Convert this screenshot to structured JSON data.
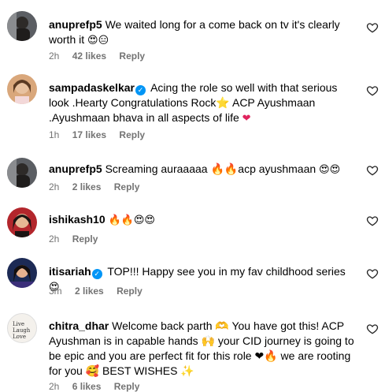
{
  "comments": [
    {
      "username": "anuprefp5",
      "verified": false,
      "text": "We waited long for a come back on tv it's clearly worth it",
      "emoji": "😍😑",
      "time": "2h",
      "likes": "42 likes",
      "reply": "Reply"
    },
    {
      "username": "sampadaskelkar",
      "verified": true,
      "text": "Acing the role so well with that serious look .Hearty Congratulations Rock⭐ ACP Ayushmaan .Ayushmaan bhava in all aspects of life",
      "emoji": "❤",
      "time": "1h",
      "likes": "17 likes",
      "reply": "Reply"
    },
    {
      "username": "anuprefp5",
      "verified": false,
      "text": "Screaming auraaaaa 🔥🔥acp ayushmaan",
      "emoji": "😍😍",
      "time": "2h",
      "likes": "2 likes",
      "reply": "Reply"
    },
    {
      "username": "ishikash10",
      "verified": false,
      "text": "",
      "emoji": "🔥🔥😍😍",
      "time": "2h",
      "likes": "",
      "reply": "Reply"
    },
    {
      "username": "itisariah",
      "verified": true,
      "text": "TOP!!! Happy see you in my fav childhood series",
      "emoji": "😍",
      "time": "3m",
      "likes": "2 likes",
      "reply": "Reply"
    },
    {
      "username": "chitra_dhar",
      "verified": false,
      "text": "Welcome back parth 🫶 You have got this! ACP Ayushman is in capable hands 🙌 your CID journey is going to be epic and you are perfect fit for this role ❤🔥 we are rooting for you 🥰 BEST WISHES ✨",
      "emoji": "",
      "time": "2h",
      "likes": "6 likes",
      "reply": "Reply"
    }
  ],
  "avatar_text": "Live Laugh Love",
  "colors": {
    "meta": "#737373",
    "verified": "#0095f6",
    "emoji_face": "#f7c531",
    "heart_eyes": "#e0245e"
  }
}
